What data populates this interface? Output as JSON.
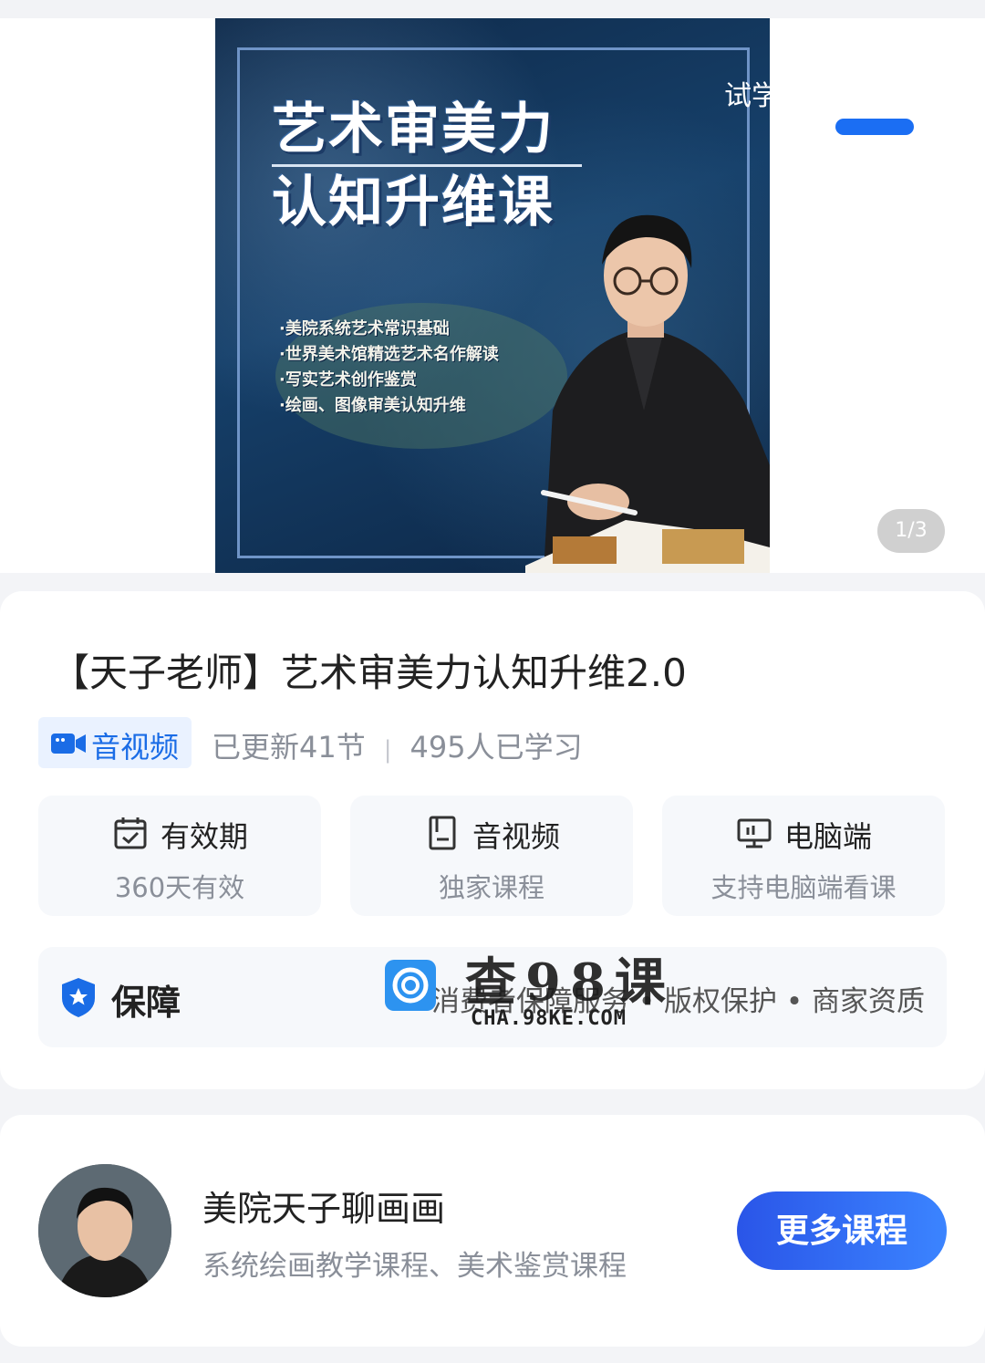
{
  "banner": {
    "cover_title_line1": "艺术审美力",
    "cover_title_line2": "认知升维课",
    "cover_bullets": [
      "·美院系统艺术常识基础",
      "·世界美术馆精选艺术名作解读",
      "·写实艺术创作鉴赏",
      "·绘画、图像审美认知升维"
    ],
    "try_label": "试学",
    "page_counter": "1/3",
    "accent_color": "#1b6ef3"
  },
  "course": {
    "title": "【天子老师】艺术审美力认知升维2.0",
    "media_badge": "音视频",
    "updated": "已更新41节",
    "separator": "|",
    "learners": "495人已学习",
    "features": [
      {
        "icon": "calendar-check-icon",
        "name": "有效期",
        "desc": "360天有效"
      },
      {
        "icon": "book-icon",
        "name": "音视频",
        "desc": "独家课程"
      },
      {
        "icon": "monitor-icon",
        "name": "电脑端",
        "desc": "支持电脑端看课"
      }
    ],
    "guarantee": {
      "label": "保障",
      "items": "消费者保障服务 • 版权保护 • 商家资质"
    }
  },
  "teacher": {
    "name": "美院天子聊画画",
    "desc": "系统绘画教学课程、美术鉴赏课程",
    "more_button": "更多课程",
    "button_color": "#2f66f0"
  },
  "watermark": {
    "text": "查98课",
    "url": "CHA.98KE.COM"
  }
}
